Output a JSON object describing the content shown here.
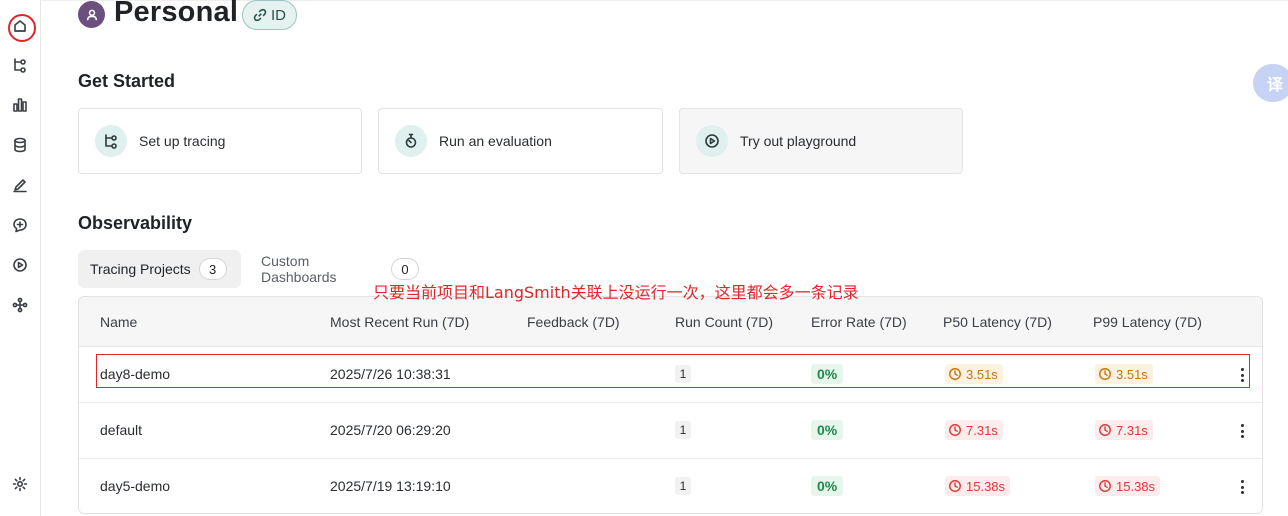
{
  "header": {
    "title": "Personal",
    "id_badge_label": "ID"
  },
  "translate_label": "译",
  "get_started": {
    "title": "Get Started",
    "cards": [
      {
        "label": "Set up tracing",
        "icon": "tracing-icon"
      },
      {
        "label": "Run an evaluation",
        "icon": "stopwatch-icon"
      },
      {
        "label": "Try out playground",
        "icon": "play-circle-icon"
      }
    ]
  },
  "observability": {
    "title": "Observability",
    "tabs": [
      {
        "label": "Tracing Projects",
        "count": "3",
        "active": true
      },
      {
        "label": "Custom Dashboards",
        "count": "0",
        "active": false
      }
    ]
  },
  "annotation": "只要当前项目和LangSmith关联上没运行一次，这里都会多一条记录",
  "table": {
    "columns": [
      "Name",
      "Most Recent Run (7D)",
      "Feedback (7D)",
      "Run Count (7D)",
      "Error Rate (7D)",
      "P50 Latency (7D)",
      "P99 Latency (7D)"
    ],
    "rows": [
      {
        "name": "day8-demo",
        "recent_run": "2025/7/26 10:38:31",
        "feedback": "",
        "run_count": "1",
        "error_rate": "0%",
        "p50": "3.51s",
        "p99": "3.51s",
        "latency_color": "#c9740d"
      },
      {
        "name": "default",
        "recent_run": "2025/7/20 06:29:20",
        "feedback": "",
        "run_count": "1",
        "error_rate": "0%",
        "p50": "7.31s",
        "p99": "7.31s",
        "latency_color": "#d93a3a"
      },
      {
        "name": "day5-demo",
        "recent_run": "2025/7/19 13:19:10",
        "feedback": "",
        "run_count": "1",
        "error_rate": "0%",
        "p50": "15.38s",
        "p99": "15.38s",
        "latency_color": "#d93a3a"
      }
    ]
  },
  "sidebar": {
    "icons": [
      "home-icon",
      "tracing-icon",
      "bar-chart-icon",
      "database-icon",
      "pencil-icon",
      "chat-plus-icon",
      "play-circle-icon",
      "nodes-icon",
      "settings-icon"
    ]
  },
  "colors": {
    "accent_red": "#e0262b",
    "success_green": "#1e8a4a",
    "warning_orange": "#c9740d",
    "danger_red": "#d93a3a"
  }
}
